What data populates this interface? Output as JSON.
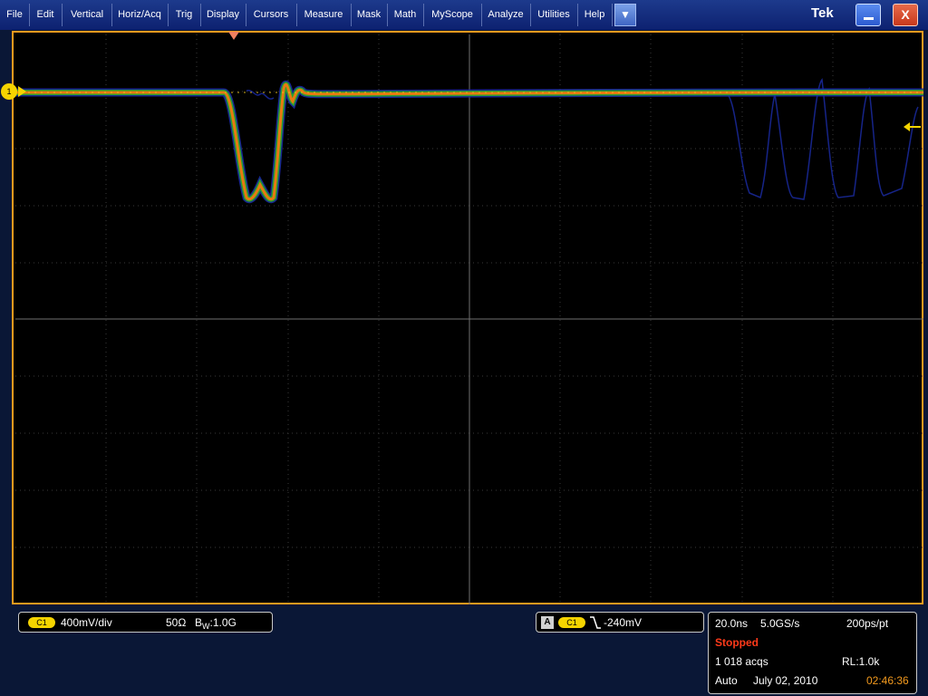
{
  "menu": {
    "items": [
      "File",
      "Edit",
      "Vertical",
      "Horiz/Acq",
      "Trig",
      "Display",
      "Cursors",
      "Measure",
      "Mask",
      "Math",
      "MyScope",
      "Analyze",
      "Utilities",
      "Help"
    ],
    "dropdown_glyph": "▼",
    "brand": "Tek",
    "minimize_glyph": "minimize-icon",
    "close_label": "X"
  },
  "channel": {
    "marker_label": "1",
    "color": "#f5d400",
    "badge": "C1",
    "scale": "400mV/div",
    "impedance": "50Ω",
    "bandwidth_prefix": "B",
    "bandwidth_sub": "W",
    "bandwidth_value": ":1.0G"
  },
  "trigger": {
    "source_letter": "A",
    "source_badge": "C1",
    "slope_icon": "falling-edge-icon",
    "level": "-240mV"
  },
  "acquisition": {
    "timebase": "20.0ns",
    "sample_rate": "5.0GS/s",
    "resolution": "200ps/pt",
    "state": "Stopped",
    "state_color": "#ff3a1a",
    "acqs": "1 018 acqs",
    "record_length": "RL:1.0k",
    "mode": "Auto",
    "date": "July 02, 2010",
    "time": "02:46:36",
    "time_color": "#f39a1e"
  },
  "colors": {
    "frame": "#f39a1e",
    "trace_main": "#e87a10",
    "trace_mid": "#2aa030",
    "trace_low": "#1a2aa0",
    "grid": "#707070"
  }
}
